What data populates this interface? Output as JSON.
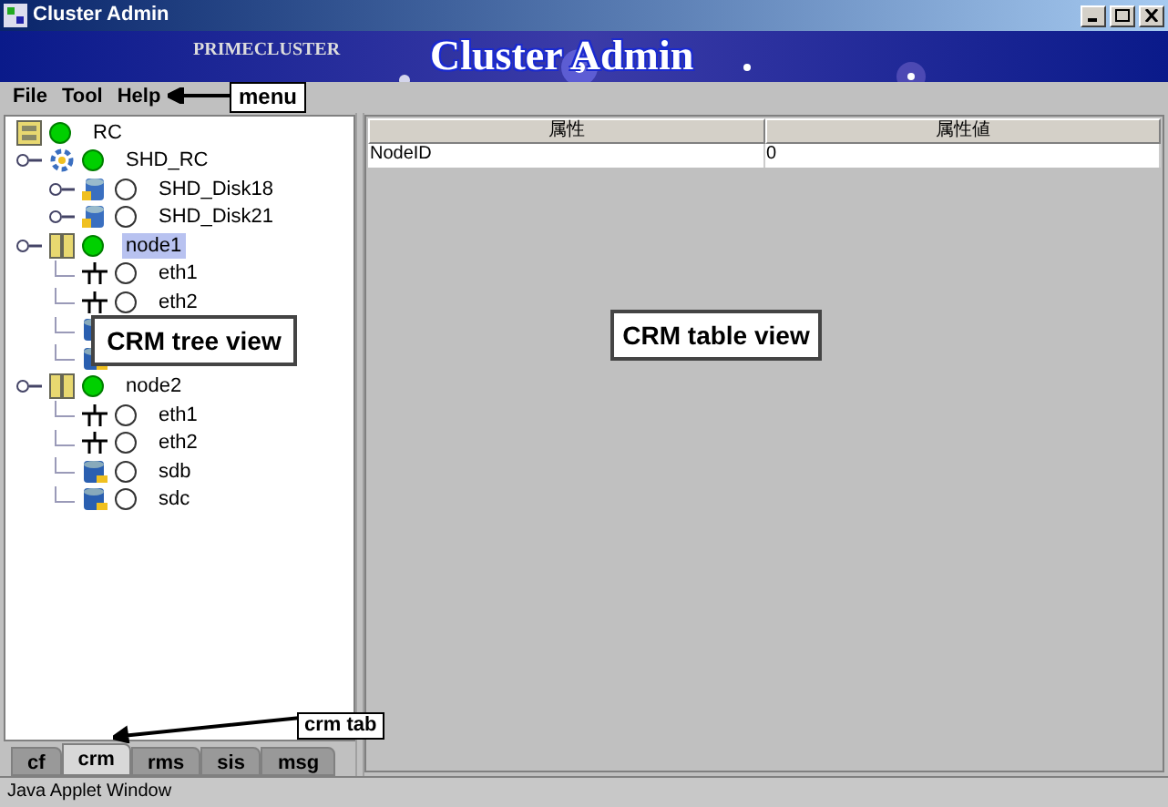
{
  "window": {
    "title": "Cluster Admin"
  },
  "banner": {
    "product": "PRIMECLUSTER",
    "title": "Cluster Admin"
  },
  "menu": [
    "File",
    "Tool",
    "Help"
  ],
  "tree": [
    {
      "label": "RC",
      "kind": "cluster",
      "online": true,
      "selected": false,
      "children": [
        {
          "label": "SHD_RC",
          "kind": "shared",
          "online": true,
          "selected": false,
          "children": [
            {
              "label": "SHD_Disk18",
              "kind": "shared-disk",
              "online": false,
              "selected": false,
              "expandable": true
            },
            {
              "label": "SHD_Disk21",
              "kind": "shared-disk",
              "online": false,
              "selected": false,
              "expandable": true
            }
          ]
        },
        {
          "label": "node1",
          "kind": "node",
          "online": true,
          "selected": true,
          "children": [
            {
              "label": "eth1",
              "kind": "network",
              "online": false,
              "selected": false
            },
            {
              "label": "eth2",
              "kind": "network",
              "online": false,
              "selected": false
            },
            {
              "kind": "disk"
            },
            {
              "kind": "disk"
            }
          ]
        },
        {
          "label": "node2",
          "kind": "node",
          "online": true,
          "selected": false,
          "children": [
            {
              "label": "eth1",
              "kind": "network",
              "online": false,
              "selected": false
            },
            {
              "label": "eth2",
              "kind": "network",
              "online": false,
              "selected": false
            },
            {
              "label": "sdb",
              "kind": "disk",
              "online": false,
              "selected": false
            },
            {
              "label": "sdc",
              "kind": "disk",
              "online": false,
              "selected": false
            }
          ]
        }
      ]
    }
  ],
  "tabs": [
    {
      "label": "cf",
      "selected": false
    },
    {
      "label": "crm",
      "selected": true
    },
    {
      "label": "rms",
      "selected": false
    },
    {
      "label": "sis",
      "selected": false
    },
    {
      "label": "msg",
      "selected": false
    }
  ],
  "table": {
    "columns": [
      "属性",
      "属性値"
    ],
    "rows": [
      [
        "NodeID",
        "0"
      ]
    ]
  },
  "callouts": {
    "menu": "menu",
    "tree": "CRM tree view",
    "table": "CRM table view",
    "tab": "crm tab"
  },
  "status_bar": "Java Applet Window"
}
